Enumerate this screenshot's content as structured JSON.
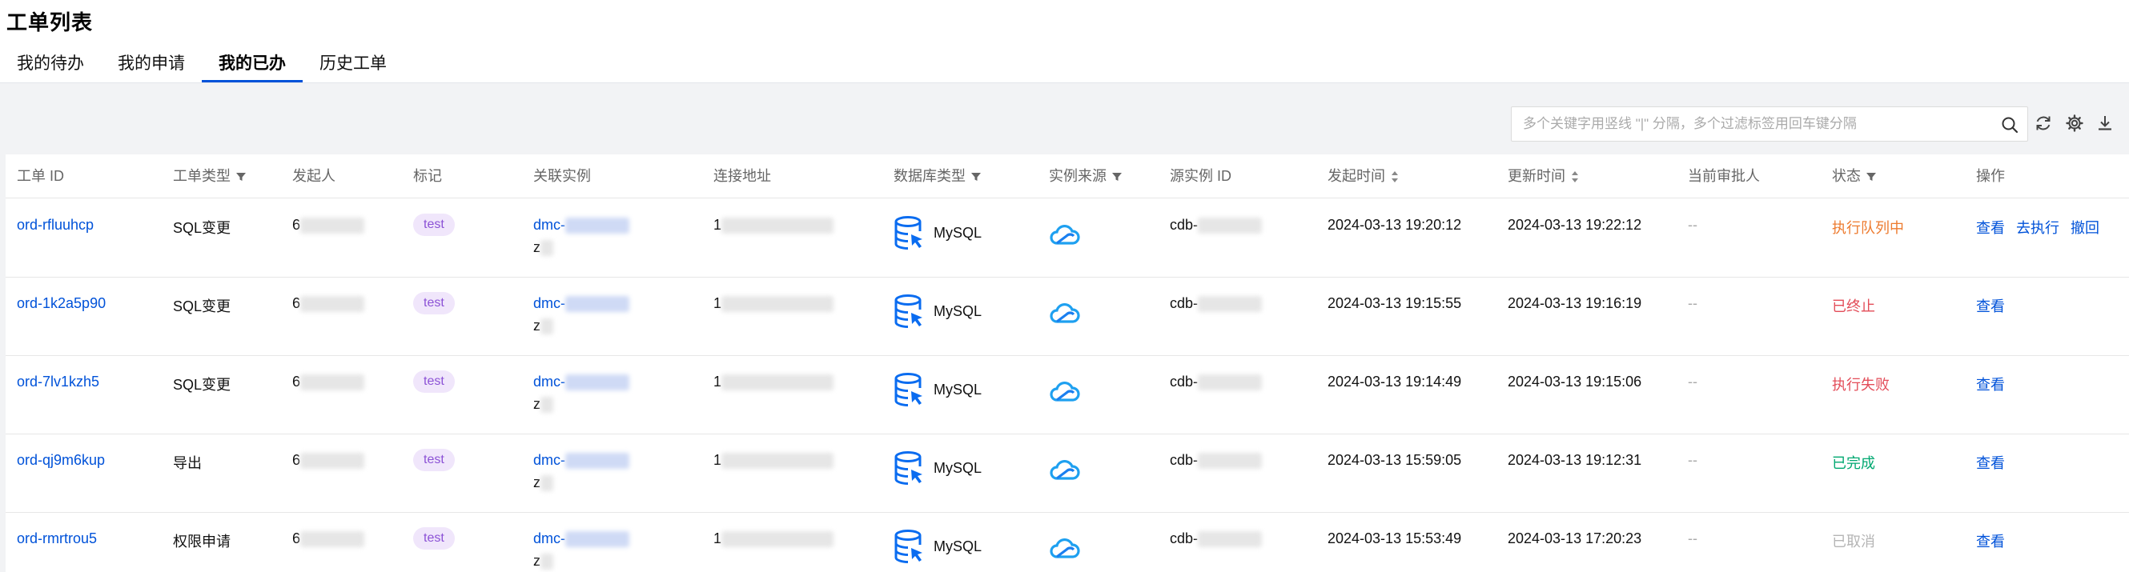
{
  "page": {
    "title": "工单列表"
  },
  "tabs": [
    {
      "label": "我的待办",
      "active": false
    },
    {
      "label": "我的申请",
      "active": false
    },
    {
      "label": "我的已办",
      "active": true
    },
    {
      "label": "历史工单",
      "active": false
    }
  ],
  "search": {
    "placeholder": "多个关键字用竖线 \"|\" 分隔，多个过滤标签用回车键分隔",
    "value": ""
  },
  "toolbar": {
    "icons": [
      "refresh-icon",
      "settings-icon",
      "download-icon"
    ]
  },
  "table": {
    "columns": [
      "工单 ID",
      "工单类型",
      "发起人",
      "标记",
      "关联实例",
      "连接地址",
      "数据库类型",
      "实例来源",
      "源实例 ID",
      "发起时间",
      "更新时间",
      "当前审批人",
      "状态",
      "操作"
    ],
    "rows": [
      {
        "id": "ord-rfluuhcp",
        "type": "SQL变更",
        "initiator": "6",
        "tag": "test",
        "instance_prefix": "dmc-",
        "instance_line2": "z",
        "address": "1",
        "db_type": "MySQL",
        "source_icon": "cloud-icon",
        "source_id": "cdb-",
        "created": "2024-03-13 19:20:12",
        "updated": "2024-03-13 19:22:12",
        "approver": "--",
        "status": "执行队列中",
        "status_color": "#ed7b2f",
        "actions": [
          "查看",
          "去执行",
          "撤回"
        ]
      },
      {
        "id": "ord-1k2a5p90",
        "type": "SQL变更",
        "initiator": "6",
        "tag": "test",
        "instance_prefix": "dmc-",
        "instance_line2": "z",
        "address": "1",
        "db_type": "MySQL",
        "source_icon": "cloud-icon",
        "source_id": "cdb-",
        "created": "2024-03-13 19:15:55",
        "updated": "2024-03-13 19:16:19",
        "approver": "--",
        "status": "已终止",
        "status_color": "#e34d59",
        "actions": [
          "查看"
        ]
      },
      {
        "id": "ord-7lv1kzh5",
        "type": "SQL变更",
        "initiator": "6",
        "tag": "test",
        "instance_prefix": "dmc-",
        "instance_line2": "z",
        "address": "1",
        "db_type": "MySQL",
        "source_icon": "cloud-icon",
        "source_id": "cdb-",
        "created": "2024-03-13 19:14:49",
        "updated": "2024-03-13 19:15:06",
        "approver": "--",
        "status": "执行失败",
        "status_color": "#e34d59",
        "actions": [
          "查看"
        ]
      },
      {
        "id": "ord-qj9m6kup",
        "type": "导出",
        "initiator": "6",
        "tag": "test",
        "instance_prefix": "dmc-",
        "instance_line2": "z",
        "address": "1",
        "db_type": "MySQL",
        "source_icon": "cloud-icon",
        "source_id": "cdb-",
        "created": "2024-03-13 15:59:05",
        "updated": "2024-03-13 19:12:31",
        "approver": "--",
        "status": "已完成",
        "status_color": "#00a870",
        "actions": [
          "查看"
        ]
      },
      {
        "id": "ord-rmrtrou5",
        "type": "权限申请",
        "initiator": "6",
        "tag": "test",
        "instance_prefix": "dmc-",
        "instance_line2": "z",
        "address": "1",
        "db_type": "MySQL",
        "source_icon": "cloud-icon",
        "source_id": "cdb-",
        "created": "2024-03-13 15:53:49",
        "updated": "2024-03-13 17:20:23",
        "approver": "--",
        "status": "已取消",
        "status_color": "#b5b5b5",
        "actions": [
          "查看"
        ]
      }
    ]
  }
}
